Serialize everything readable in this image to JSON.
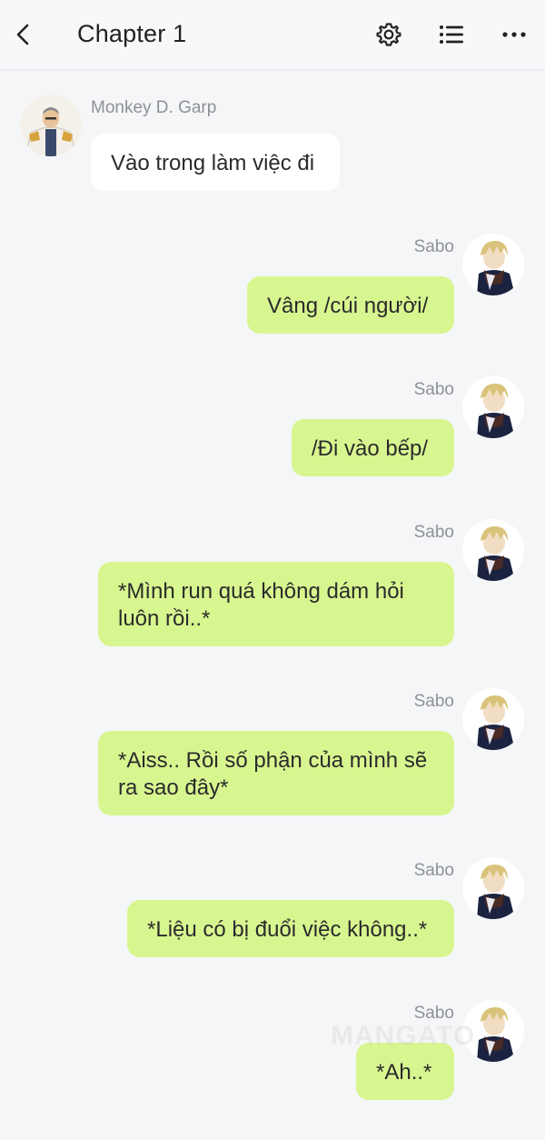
{
  "header": {
    "title": "Chapter 1",
    "back_icon": "chevron-left-icon",
    "settings_icon": "gear-icon",
    "list_icon": "list-icon",
    "more_icon": "more-horizontal-icon"
  },
  "messages": [
    {
      "sender": "Monkey D. Garp",
      "side": "left",
      "text": "Vào trong làm việc đi"
    },
    {
      "sender": "Sabo",
      "side": "right",
      "text": "Vâng /cúi người/"
    },
    {
      "sender": "Sabo",
      "side": "right",
      "text": "/Đi vào bếp/"
    },
    {
      "sender": "Sabo",
      "side": "right",
      "text": "*Mình run quá không dám hỏi luôn rồi..*"
    },
    {
      "sender": "Sabo",
      "side": "right",
      "text": "*Aiss.. Rồi số phận của mình sẽ ra sao đây*"
    },
    {
      "sender": "Sabo",
      "side": "right",
      "text": "*Liệu có bị đuổi việc không..*"
    },
    {
      "sender": "Sabo",
      "side": "right",
      "text": "*Ah..*"
    }
  ],
  "watermark": "MANGATO",
  "colors": {
    "background": "#f5f6f8",
    "left_bubble": "#ffffff",
    "right_bubble": "#d8f690",
    "name_text": "#8e9196"
  }
}
